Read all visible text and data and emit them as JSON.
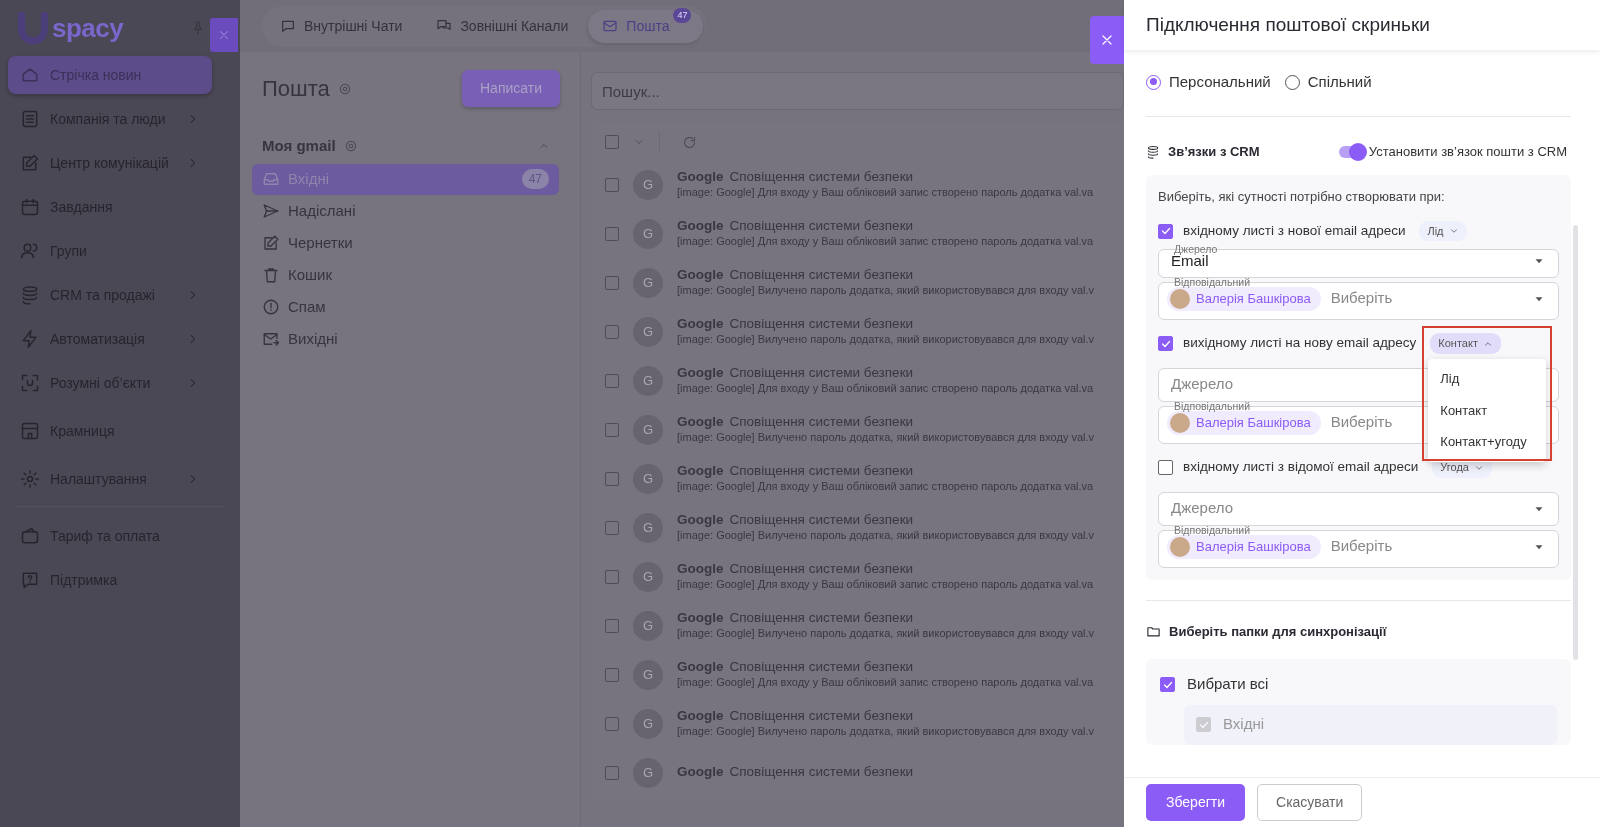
{
  "sidebar": {
    "logo": "spacy",
    "items": [
      {
        "label": "Стрічка новин",
        "selected": true,
        "has_submenu": false
      },
      {
        "label": "Компанія та люди",
        "selected": false,
        "has_submenu": true
      },
      {
        "label": "Центр комунікацій",
        "selected": false,
        "has_submenu": true
      },
      {
        "label": "Завдання",
        "selected": false,
        "has_submenu": false
      },
      {
        "label": "Групи",
        "selected": false,
        "has_submenu": false
      },
      {
        "label": "CRM та продажі",
        "selected": false,
        "has_submenu": true
      },
      {
        "label": "Автоматизація",
        "selected": false,
        "has_submenu": true
      },
      {
        "label": "Розумні об’єкти",
        "selected": false,
        "has_submenu": true
      },
      {
        "label": "Крамниця",
        "selected": false,
        "has_submenu": false
      },
      {
        "label": "Налаштування",
        "selected": false,
        "has_submenu": true
      }
    ],
    "bottom_items": [
      {
        "label": "Тариф та оплата",
        "selected": false,
        "has_submenu": false
      },
      {
        "label": "Підтримка",
        "selected": false,
        "has_submenu": false
      }
    ]
  },
  "top_tabs": [
    {
      "label": "Внутрішні Чати",
      "selected": false
    },
    {
      "label": "Зовнішні Канали",
      "selected": false
    },
    {
      "label": "Пошта",
      "selected": true,
      "badge": "47"
    }
  ],
  "mail_nav": {
    "title": "Пошта",
    "compose_button": "Написати",
    "account": {
      "name": "Моя gmail",
      "expanded": true
    },
    "folders": [
      {
        "label": "Вхідні",
        "selected": true,
        "count": "47"
      },
      {
        "label": "Надіслані",
        "selected": false
      },
      {
        "label": "Чернетки",
        "selected": false
      },
      {
        "label": "Кошик",
        "selected": false
      },
      {
        "label": "Спам",
        "selected": false
      },
      {
        "label": "Вихідні",
        "selected": false
      }
    ]
  },
  "mail_list": {
    "search": {
      "placeholder": "Пошук..."
    },
    "select_all_checked": false,
    "messages": [
      {
        "avatar": "G",
        "sender": "Google",
        "subject": "Сповіщення системи безпеки",
        "preview": "[image: Google] Для входу у Ваш обліковий запис створено пароль додатка val.va",
        "checked": false
      },
      {
        "avatar": "G",
        "sender": "Google",
        "subject": "Сповіщення системи безпеки",
        "preview": "[image: Google] Для входу у Ваш обліковий запис створено пароль додатка val.va",
        "checked": false
      },
      {
        "avatar": "G",
        "sender": "Google",
        "subject": "Сповіщення системи безпеки",
        "preview": "[image: Google] Вилучено пароль додатка, який використовувався для входу val.v",
        "checked": false
      },
      {
        "avatar": "G",
        "sender": "Google",
        "subject": "Сповіщення системи безпеки",
        "preview": "[image: Google] Вилучено пароль додатка, який використовувався для входу val.v",
        "checked": false
      },
      {
        "avatar": "G",
        "sender": "Google",
        "subject": "Сповіщення системи безпеки",
        "preview": "[image: Google] Для входу у Ваш обліковий запис створено пароль додатка val.va",
        "checked": false
      },
      {
        "avatar": "G",
        "sender": "Google",
        "subject": "Сповіщення системи безпеки",
        "preview": "[image: Google] Вилучено пароль додатка, який використовувався для входу val.v",
        "checked": false
      },
      {
        "avatar": "G",
        "sender": "Google",
        "subject": "Сповіщення системи безпеки",
        "preview": "[image: Google] Для входу у Ваш обліковий запис створено пароль додатка val.va",
        "checked": false
      },
      {
        "avatar": "G",
        "sender": "Google",
        "subject": "Сповіщення системи безпеки",
        "preview": "[image: Google] Вилучено пароль додатка, який використовувався для входу val.v",
        "checked": false
      },
      {
        "avatar": "G",
        "sender": "Google",
        "subject": "Сповіщення системи безпеки",
        "preview": "[image: Google] Для входу у Ваш обліковий запис створено пароль додатка val.va",
        "checked": false
      },
      {
        "avatar": "G",
        "sender": "Google",
        "subject": "Сповіщення системи безпеки",
        "preview": "[image: Google] Вилучено пароль додатка, який використовувався для входу val.v",
        "checked": false
      },
      {
        "avatar": "G",
        "sender": "Google",
        "subject": "Сповіщення системи безпеки",
        "preview": "[image: Google] Для входу у Ваш обліковий запис створено пароль додатка val.va",
        "checked": false
      },
      {
        "avatar": "G",
        "sender": "Google",
        "subject": "Сповіщення системи безпеки",
        "preview": "[image: Google] Вилучено пароль додатка, який використовувався для входу val.v",
        "checked": false
      },
      {
        "avatar": "G",
        "sender": "Google",
        "subject": "Сповіщення системи безпеки",
        "checked": false
      }
    ]
  },
  "drawer": {
    "title": "Підключення поштової скриньки",
    "mailbox_type": [
      {
        "label": "Персональний",
        "selected": true
      },
      {
        "label": "Спільний",
        "selected": false
      }
    ],
    "crm": {
      "title": "Зв’язки з CRM",
      "toggle": {
        "label": "Установити зв’язок пошти з CRM",
        "on": true
      },
      "intro": "Виберіть, які сутності потрібно створювати при:",
      "rules": [
        {
          "label": "вхідному листі з нової email адреси",
          "checked": true,
          "entity": {
            "label": "Лід",
            "open": false
          },
          "source": {
            "label": "Джерело",
            "value": "Email"
          },
          "responsible": {
            "label": "Відповідальний",
            "chips": [
              "Валерія Башкірова"
            ],
            "placeholder": "Виберіть"
          }
        },
        {
          "label": "вихідному листі на нову email адресу",
          "checked": true,
          "entity": {
            "label": "Контакт",
            "open": true,
            "highlighted": true,
            "options": [
              {
                "label": "Лід"
              },
              {
                "label": "Контакт"
              },
              {
                "label": "Контакт+угоду"
              }
            ]
          },
          "source": {
            "placeholder": "Джерело"
          },
          "responsible": {
            "label": "Відповідальний",
            "chips": [
              "Валерія Башкірова"
            ],
            "placeholder": "Виберіть"
          }
        },
        {
          "label": "вхідному листі з відомої email адреси",
          "checked": false,
          "entity": {
            "label": "Угода",
            "open": false
          },
          "source": {
            "placeholder": "Джерело"
          },
          "responsible": {
            "label": "Відповідальний",
            "chips": [
              "Валерія Башкірова"
            ],
            "placeholder": "Виберіть"
          }
        }
      ]
    },
    "sync": {
      "title": "Виберіть папки для синхронізації",
      "select_all": {
        "label": "Вибрати всі",
        "checked": true
      },
      "folders": [
        {
          "label": "Вхідні",
          "checked": true,
          "disabled": true
        }
      ]
    },
    "buttons": [
      {
        "label": "Зберегти",
        "kind": "primary"
      },
      {
        "label": "Скасувати",
        "kind": "secondary"
      }
    ]
  }
}
